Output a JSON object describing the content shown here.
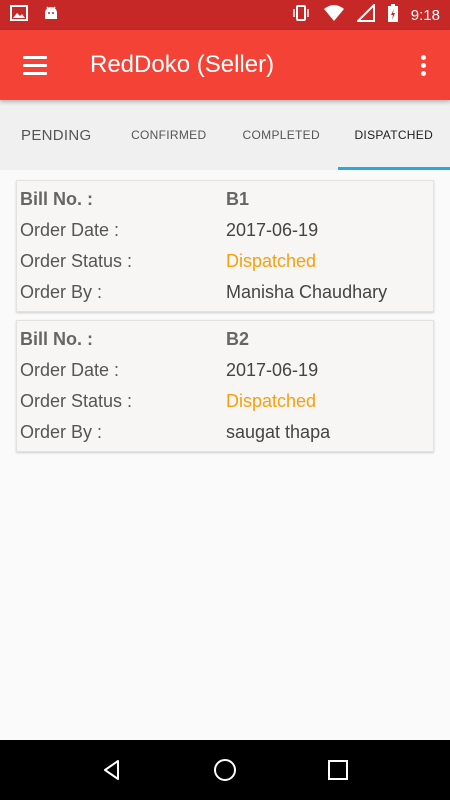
{
  "statusbar": {
    "time": "9:18"
  },
  "appbar": {
    "title": "RedDoko (Seller)"
  },
  "tabs": [
    {
      "label": "PENDING"
    },
    {
      "label": "CONFIRMED"
    },
    {
      "label": "COMPLETED"
    },
    {
      "label": "DISPATCHED"
    }
  ],
  "labels": {
    "bill_no": "Bill No. :",
    "order_date": "Order Date :",
    "order_status": "Order Status :",
    "order_by": "Order By :"
  },
  "orders": [
    {
      "bill_no": "B1",
      "order_date": "2017-06-19",
      "order_status": "Dispatched",
      "order_by": "Manisha Chaudhary"
    },
    {
      "bill_no": "B2",
      "order_date": "2017-06-19",
      "order_status": "Dispatched",
      "order_by": "saugat thapa"
    }
  ],
  "colors": {
    "primary": "#f44336",
    "status_bar": "#c62828",
    "tab_indicator": "#29a9e0",
    "dispatched": "#f5a00f"
  },
  "icons": [
    "image-icon",
    "android-icon",
    "vibrate-icon",
    "wifi-icon",
    "signal-icon",
    "battery-icon",
    "menu-icon",
    "more-vert-icon",
    "back-icon",
    "home-icon",
    "recents-icon"
  ]
}
